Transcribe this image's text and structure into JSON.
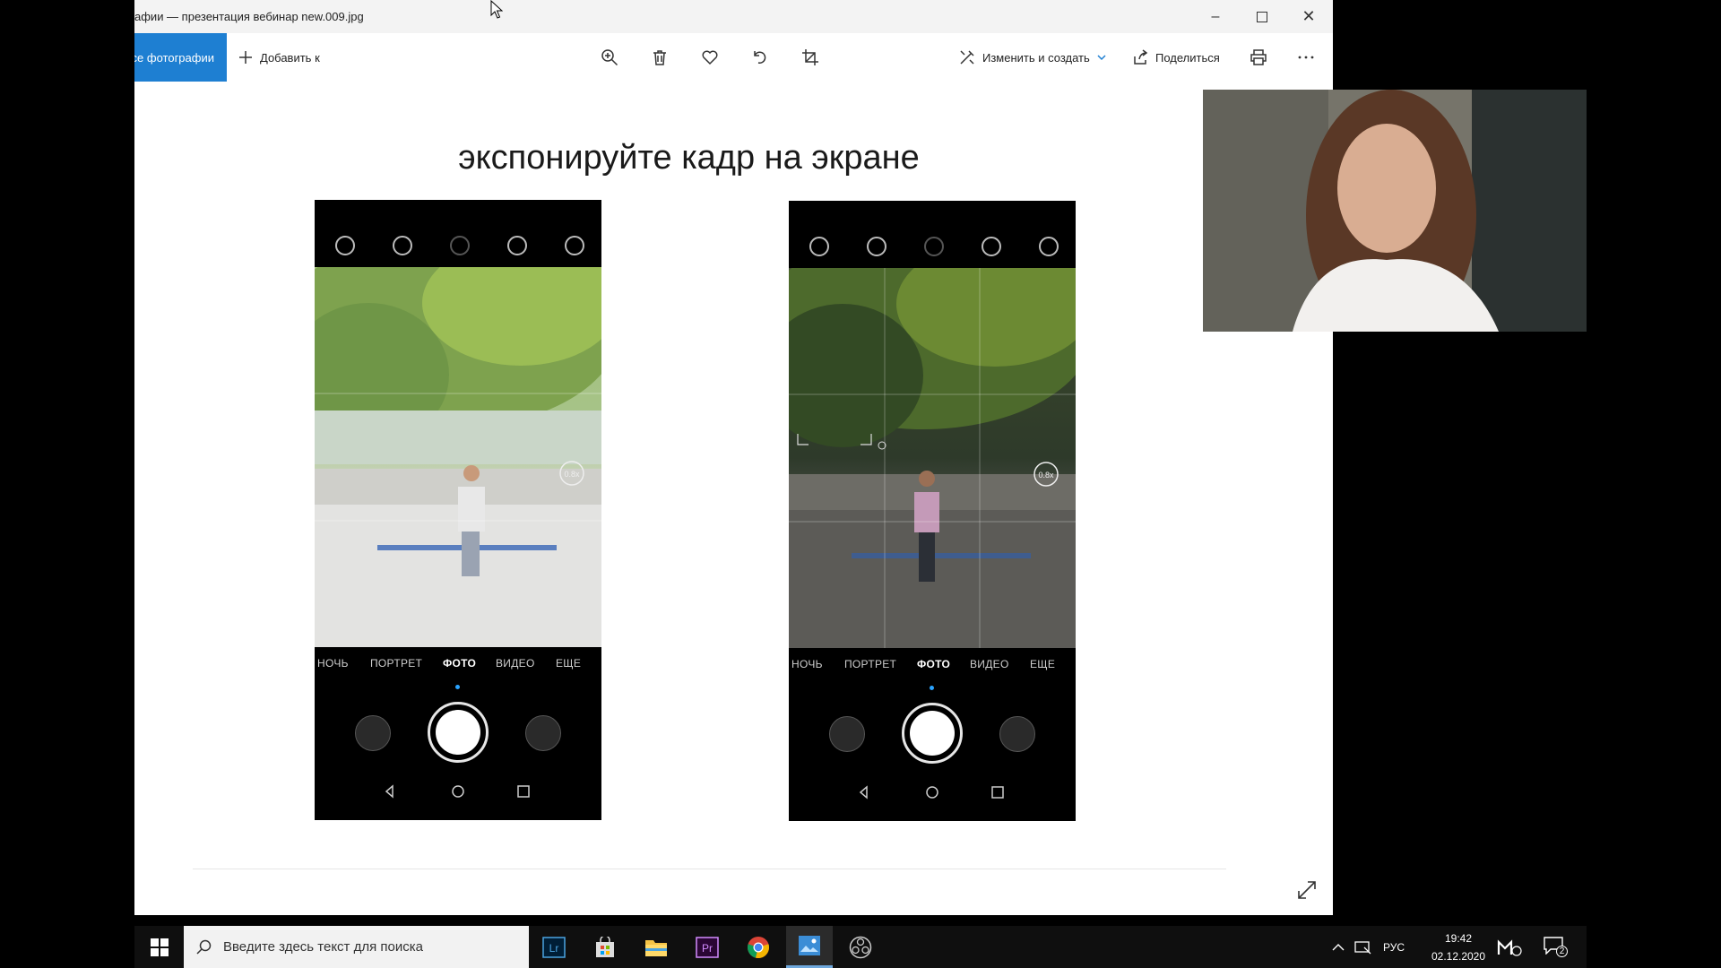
{
  "window": {
    "title": "афии — презентация вебинар new.009.jpg",
    "controls": [
      "minimize-icon",
      "maximize-icon",
      "close-icon"
    ]
  },
  "toolbar": {
    "all_photos_label": "се фотографии",
    "add_to_label": "Добавить к",
    "icons": [
      "zoom-icon",
      "trash-icon",
      "heart-icon",
      "rotate-icon",
      "crop-icon"
    ],
    "edit_create_label": "Изменить и создать",
    "share_label": "Поделиться",
    "print_icon": "print-icon",
    "more_icon": "more-icon"
  },
  "slide": {
    "title": "экспонируйте кадр на экране",
    "phones": [
      {
        "modes": [
          "НОЧЬ",
          "ПОРТРЕТ",
          "ФОТО",
          "ВИДЕО",
          "ЕЩЕ"
        ],
        "active_mode": "ФОТО",
        "zoom_badge": "0.8x",
        "exposure": "bright"
      },
      {
        "modes": [
          "НОЧЬ",
          "ПОРТРЕТ",
          "ФОТО",
          "ВИДЕО",
          "ЕЩЕ"
        ],
        "active_mode": "ФОТО",
        "zoom_badge": "0.8x",
        "exposure": "dark"
      }
    ]
  },
  "taskbar": {
    "search_placeholder": "Введите здесь текст для поиска",
    "apps": [
      "lightroom-icon",
      "store-icon",
      "file-explorer-icon",
      "premiere-icon",
      "chrome-icon",
      "photos-icon",
      "obs-icon"
    ],
    "active_app": "photos-icon",
    "language": "РУС",
    "time": "19:42",
    "date": "02.12.2020",
    "notification_count": "2"
  },
  "colors": {
    "accent": "#1e7fd2",
    "taskbar": "#0f0f0f",
    "titlebar": "#f3f3f3"
  }
}
